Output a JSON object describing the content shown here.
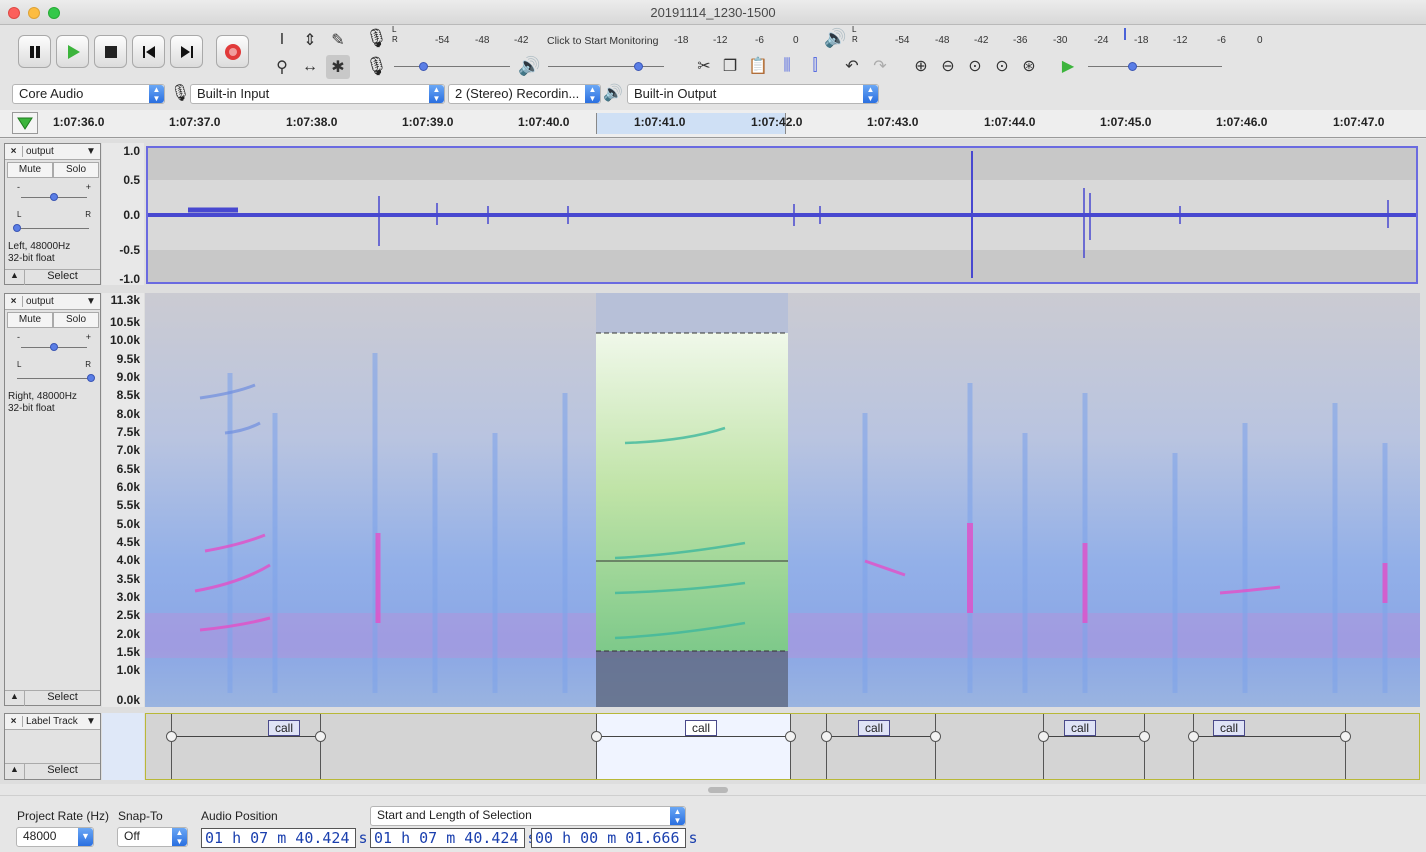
{
  "window": {
    "title": "20191114_1230-1500"
  },
  "transport": {
    "pause_icon": "pause-icon",
    "play_icon": "play-icon",
    "stop_icon": "stop-icon",
    "skip_start_icon": "skip-to-start-icon",
    "skip_end_icon": "skip-to-end-icon",
    "record_icon": "record-icon"
  },
  "recording_meter": {
    "ticks": [
      "-54",
      "-48",
      "-42",
      "-18",
      "-12",
      "-6",
      "0"
    ],
    "monitor_label": "Click to Start Monitoring",
    "lr": [
      "L",
      "R"
    ]
  },
  "playback_meter": {
    "ticks": [
      "-54",
      "-48",
      "-42",
      "-36",
      "-30",
      "-24",
      "-18",
      "-12",
      "-6",
      "0"
    ],
    "lr": [
      "L",
      "R"
    ]
  },
  "devices": {
    "host": "Core Audio",
    "input": "Built-in Input",
    "channels": "2 (Stereo) Recordin...",
    "output": "Built-in Output"
  },
  "timeline": {
    "ticks": [
      "1:07:36.0",
      "1:07:37.0",
      "1:07:38.0",
      "1:07:39.0",
      "1:07:40.0",
      "1:07:41.0",
      "1:07:42.0",
      "1:07:43.0",
      "1:07:44.0",
      "1:07:45.0",
      "1:07:46.0",
      "1:07:47.0"
    ]
  },
  "track1": {
    "name": "output",
    "mute": "Mute",
    "solo": "Solo",
    "info_line1": "Left, 48000Hz",
    "info_line2": "32-bit float",
    "select": "Select",
    "scale": [
      "1.0",
      "0.5",
      "0.0",
      "-0.5",
      "-1.0"
    ]
  },
  "track2": {
    "name": "output",
    "mute": "Mute",
    "solo": "Solo",
    "info_line1": "Right, 48000Hz",
    "info_line2": "32-bit float",
    "select": "Select",
    "scale": [
      "11.3k",
      "10.5k",
      "10.0k",
      "9.5k",
      "9.0k",
      "8.5k",
      "8.0k",
      "7.5k",
      "7.0k",
      "6.5k",
      "6.0k",
      "5.5k",
      "5.0k",
      "4.5k",
      "4.0k",
      "3.5k",
      "3.0k",
      "2.5k",
      "2.0k",
      "1.5k",
      "1.0k",
      "0.0k"
    ]
  },
  "labeltrack": {
    "name": "Label Track",
    "select": "Select",
    "labels": [
      "call",
      "call",
      "call",
      "call",
      "call"
    ]
  },
  "bottom": {
    "project_rate_label": "Project Rate (Hz)",
    "project_rate": "48000",
    "snap_label": "Snap-To",
    "snap": "Off",
    "audio_pos_label": "Audio Position",
    "audio_pos": "01 h 07 m 40.424 s",
    "selection_mode": "Start and Length of Selection",
    "sel_start": "01 h 07 m 40.424 s",
    "sel_length": "00 h 00 m 01.666 s"
  }
}
